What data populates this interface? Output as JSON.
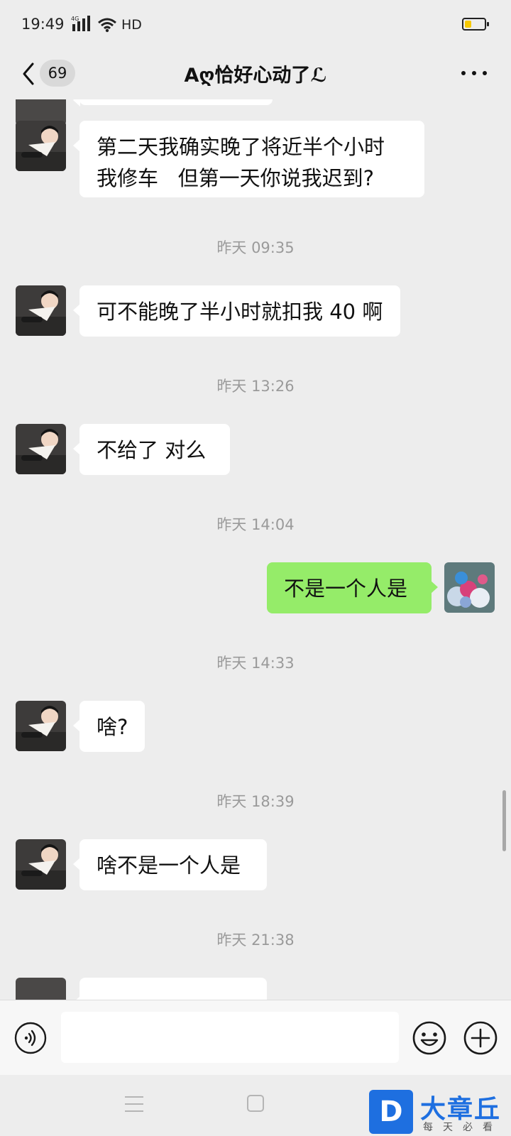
{
  "status_bar": {
    "time": "19:49",
    "network": "4G",
    "hd": "HD",
    "battery_level": 0.35
  },
  "header": {
    "unread_count": "69",
    "title": "Aღ恰好心动了ℒ"
  },
  "messages": [
    {
      "side": "left",
      "text": ""
    },
    {
      "side": "left",
      "lines": [
        "第二天我确实晚了将近半个小时",
        "我修车   但第一天你说我迟到?"
      ]
    },
    {
      "timestamp": "昨天 09:35"
    },
    {
      "side": "left",
      "text": "可不能晚了半小时就扣我 40 啊"
    },
    {
      "timestamp": "昨天 13:26"
    },
    {
      "side": "left",
      "text": "不给了 对么"
    },
    {
      "timestamp": "昨天 14:04"
    },
    {
      "side": "right",
      "text": "不是一个人是"
    },
    {
      "timestamp": "昨天 14:33"
    },
    {
      "side": "left",
      "text": "啥?"
    },
    {
      "timestamp": "昨天 18:39"
    },
    {
      "side": "left",
      "text": "啥不是一个人是"
    },
    {
      "timestamp": "昨天 21:38"
    },
    {
      "side": "left",
      "text": ""
    }
  ],
  "input": {
    "value": "",
    "placeholder": ""
  },
  "icons": {
    "back": "back-chevron-icon",
    "more": "more-icon",
    "voice": "voice-icon",
    "emoji": "emoji-icon",
    "plus": "plus-icon",
    "nav_menu": "menu-icon",
    "nav_home": "home-icon"
  },
  "colors": {
    "background": "#ededed",
    "bubble_left": "#ffffff",
    "bubble_right": "#95ec69",
    "timestamp": "#9a9a9a"
  },
  "watermark": {
    "logo_letter": "D",
    "name": "大章丘",
    "slogan": "每天必看"
  }
}
